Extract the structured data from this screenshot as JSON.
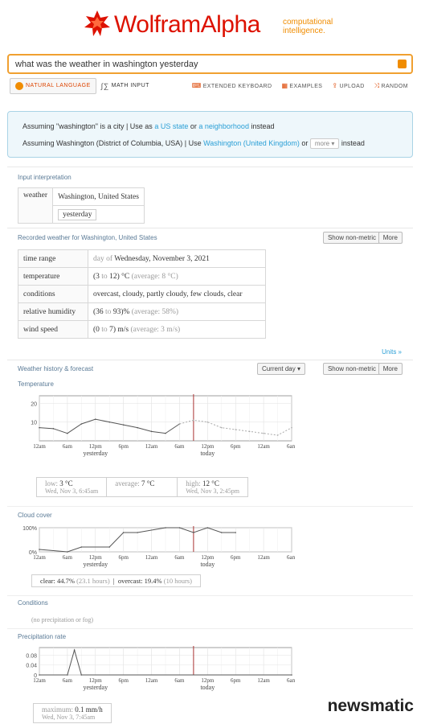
{
  "logo": {
    "name": "WolframAlpha",
    "tagline_1": "computational",
    "tagline_2": "intelligence."
  },
  "search": {
    "query": "what was the weather in washington yesterday"
  },
  "modes": {
    "natural": "NATURAL LANGUAGE",
    "math": "MATH INPUT"
  },
  "tools": {
    "keyboard": "EXTENDED KEYBOARD",
    "examples": "EXAMPLES",
    "upload": "UPLOAD",
    "random": "RANDOM"
  },
  "assumptions": {
    "l1_pre": "Assuming \"washington\" is a city | Use as",
    "l1_link1": "a US state",
    "l1_or": "or",
    "l1_link2": "a neighborhood",
    "l1_post": "instead",
    "l2_pre": "Assuming Washington (District of Columbia, USA) | Use",
    "l2_link": "Washington (United Kingdom)",
    "l2_or": "or",
    "l2_more": "more",
    "l2_post": "instead"
  },
  "input_interpretation": {
    "title": "Input interpretation",
    "key": "weather",
    "value": "Washington, United States",
    "when": "yesterday"
  },
  "recorded": {
    "title": "Recorded weather for Washington, United States",
    "btn_nonmetric": "Show non-metric",
    "btn_more": "More",
    "rows": {
      "time_range": {
        "k": "time range",
        "pre": "day of",
        "v": "Wednesday, November 3, 2021"
      },
      "temperature": {
        "k": "temperature",
        "lo": "3",
        "to": "to",
        "hi": "12",
        "unit": "°C",
        "avg": "(average: 8 °C)"
      },
      "conditions": {
        "k": "conditions",
        "v": "overcast, cloudy, partly cloudy, few clouds, clear"
      },
      "humidity": {
        "k": "relative humidity",
        "lo": "36",
        "to": "to",
        "hi": "93",
        "unit": "%",
        "avg": "(average: 58%)"
      },
      "wind": {
        "k": "wind speed",
        "lo": "0",
        "to": "to",
        "hi": "7",
        "unit": "m/s",
        "avg": "(average: 3 m/s)"
      }
    },
    "units": "Units »"
  },
  "history": {
    "title": "Weather history & forecast",
    "btn_current": "Current day",
    "btn_nonmetric": "Show non-metric",
    "btn_more": "More",
    "x_ticks": [
      "12am",
      "6am",
      "12pm",
      "6pm",
      "12am",
      "6am",
      "12pm",
      "6pm",
      "12am",
      "6am"
    ],
    "day_labels": [
      "yesterday",
      "today"
    ]
  },
  "temperature_section": {
    "title": "Temperature",
    "low_label": "low:",
    "low_value": "3",
    "low_unit": "°C",
    "low_time": "Wed, Nov 3, 6:45am",
    "avg_label": "average:",
    "avg_value": "7",
    "avg_unit": "°C",
    "high_label": "high:",
    "high_value": "12",
    "high_unit": "°C",
    "high_time": "Wed, Nov 3, 2:45pm"
  },
  "cloud_section": {
    "title": "Cloud cover",
    "clear_label": "clear:",
    "clear_value": "44.7%",
    "clear_hours": "(23.1 hours)",
    "overcast_label": "overcast:",
    "overcast_value": "19.4%",
    "overcast_hours": "(10 hours)"
  },
  "conditions_section": {
    "title": "Conditions",
    "value": "(no precipitation or fog)"
  },
  "precip_section": {
    "title": "Precipitation rate",
    "max_label": "maximum:",
    "max_value": "0.1",
    "max_unit": "mm/h",
    "max_time": "Wed, Nov 3, 7:45am"
  },
  "watermark": {
    "brand": "newsmatic"
  },
  "chart_data": [
    {
      "type": "line",
      "title": "Temperature",
      "x_ticks": [
        "12am",
        "6am",
        "12pm",
        "6pm",
        "12am",
        "6am",
        "12pm",
        "6pm",
        "12am",
        "6am"
      ],
      "yticks": [
        10,
        20
      ],
      "ylim": [
        0,
        24
      ],
      "x_hours": [
        0,
        3,
        6,
        9,
        12,
        15,
        18,
        21,
        24,
        27,
        30,
        33,
        36,
        39,
        42,
        45,
        48,
        51,
        54
      ],
      "series": [
        {
          "values": [
            7,
            6.5,
            4,
            9,
            11.5,
            10,
            8.5,
            7,
            5,
            4,
            9,
            null,
            null,
            null,
            null,
            null,
            null,
            null,
            null
          ]
        },
        {
          "values": [
            null,
            null,
            null,
            null,
            null,
            null,
            null,
            null,
            null,
            null,
            9,
            11,
            10,
            7,
            6,
            5,
            4,
            3,
            7
          ]
        }
      ]
    },
    {
      "type": "line",
      "title": "Cloud cover",
      "x_ticks": [
        "12am",
        "6am",
        "12pm",
        "6pm",
        "12am",
        "6am",
        "12pm",
        "6pm",
        "12am",
        "6am"
      ],
      "yticks": [
        "0%",
        "100%"
      ],
      "ylim": [
        0,
        100
      ],
      "x_hours": [
        0,
        6,
        9,
        15,
        18,
        21,
        27,
        30,
        33,
        36,
        39,
        42,
        45,
        48,
        51,
        54
      ],
      "series": [
        {
          "values": [
            10,
            0,
            20,
            20,
            80,
            80,
            100,
            100,
            80,
            100,
            80,
            80,
            null,
            null,
            null,
            null
          ]
        }
      ]
    },
    {
      "type": "line",
      "title": "Precipitation rate",
      "x_ticks": [
        "12am",
        "6am",
        "12pm",
        "6pm",
        "12am",
        "6am",
        "12pm",
        "6pm",
        "12am",
        "6am"
      ],
      "yticks": [
        0,
        0.04,
        0.08
      ],
      "ylim": [
        0,
        0.11
      ],
      "x_hours": [
        0,
        6,
        7.5,
        9,
        54
      ],
      "series": [
        {
          "values": [
            0,
            0,
            0.1,
            0,
            0
          ]
        }
      ]
    }
  ]
}
